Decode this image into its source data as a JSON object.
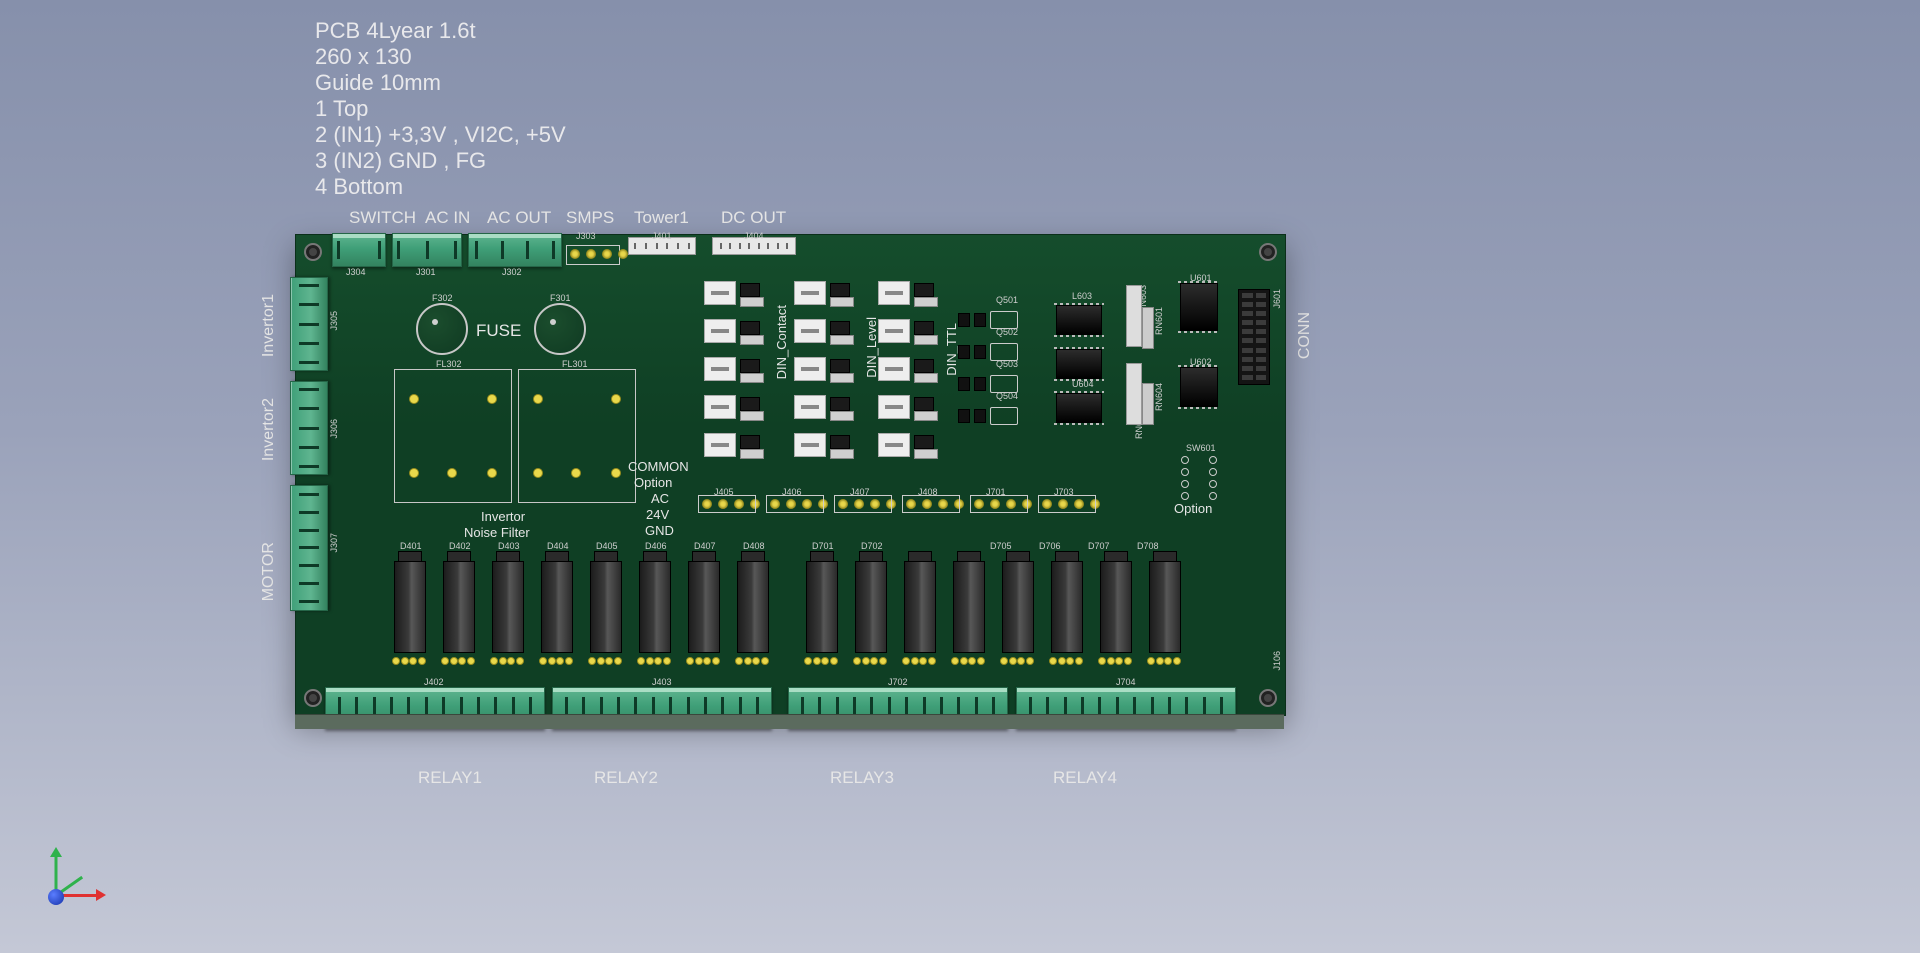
{
  "notes": {
    "l1": "PCB 4Lyear 1.6t",
    "l2": "260 x 130",
    "l3": "Guide 10mm",
    "l4": "1 Top",
    "l5": "2 (IN1) +3,3V , VI2C, +5V",
    "l6": "3 (IN2) GND , FG",
    "l7": "4 Bottom"
  },
  "top_labels": {
    "switch": "SWITCH",
    "ac_in": "AC IN",
    "ac_out": "AC OUT",
    "smps": "SMPS",
    "tower1": "Tower1",
    "dc_out": "DC OUT"
  },
  "side_labels": {
    "motor": "MOTOR",
    "inv2": "Invertor2",
    "inv1": "Invertor1",
    "conn": "CONN"
  },
  "bottom_labels": {
    "r1": "RELAY1",
    "r2": "RELAY2",
    "r3": "RELAY3",
    "r4": "RELAY4"
  },
  "silk": {
    "fuse": "FUSE",
    "inv_nf1": "Invertor",
    "inv_nf2": "Noise Filter",
    "common": "COMMON",
    "option1": "Option",
    "ac": "AC",
    "v24": "24V",
    "gnd": "GND",
    "din_contact": "DIN_Contact",
    "din_level": "DIN_Level",
    "din_ttl": "DIN_TTL",
    "option2": "Option"
  },
  "refs": {
    "j304": "J304",
    "j301": "J301",
    "j302": "J302",
    "j303": "J303",
    "j305": "J305",
    "j306": "J306",
    "j307": "J307",
    "j401": "J401",
    "j404": "J404",
    "j402": "J402",
    "j403": "J403",
    "j702": "J702",
    "j704": "J704",
    "j405": "J405",
    "j406": "J406",
    "j407": "J407",
    "j408": "J408",
    "j701": "J701",
    "j703": "J703",
    "j601": "J601",
    "j106": "J106",
    "f301": "F301",
    "f302": "F302",
    "fl301": "FL301",
    "fl302": "FL302",
    "l603": "L603",
    "u604": "U604",
    "u601": "U601",
    "u602": "U602",
    "rn601": "RN601",
    "rn602": "RN602",
    "rn603": "RN603",
    "rn604": "RN604",
    "q501": "Q501",
    "q502": "Q502",
    "q503": "Q503",
    "q504": "Q504",
    "d401": "D401",
    "d402": "D402",
    "d403": "D403",
    "d404": "D404",
    "d405": "D405",
    "d406": "D406",
    "d407": "D407",
    "d408": "D408",
    "d701": "D701",
    "d702": "D702",
    "d705": "D705",
    "d706": "D706",
    "d707": "D707",
    "d708": "D708",
    "sw601": "SW601"
  }
}
